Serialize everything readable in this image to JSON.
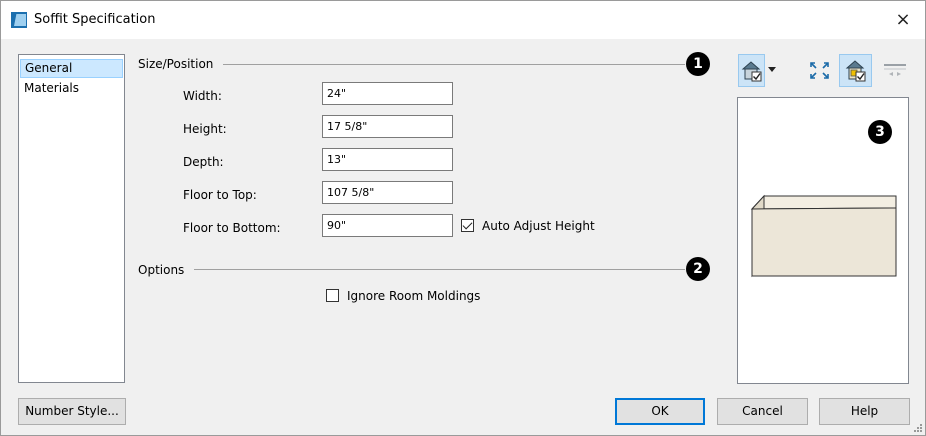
{
  "window": {
    "title": "Soffit Specification",
    "close_glyph": "×"
  },
  "sidebar": {
    "items": [
      {
        "label": "General",
        "selected": true
      },
      {
        "label": "Materials",
        "selected": false
      }
    ]
  },
  "size_position": {
    "title": "Size/Position",
    "callout": "1",
    "fields": {
      "width": {
        "label": "Width:",
        "value": "24\""
      },
      "height": {
        "label": "Height:",
        "value": "17 5/8\""
      },
      "depth": {
        "label": "Depth:",
        "value": "13\""
      },
      "floor_to_top": {
        "label": "Floor to Top:",
        "value": "107 5/8\""
      },
      "floor_to_bottom": {
        "label": "Floor to Bottom:",
        "value": "90\""
      }
    },
    "auto_adjust": {
      "label": "Auto Adjust Height",
      "checked": true
    }
  },
  "options": {
    "title": "Options",
    "callout": "2",
    "ignore_moldings": {
      "label": "Ignore Room Moldings",
      "checked": false
    }
  },
  "preview": {
    "callout": "3"
  },
  "toolbar": {
    "icons": [
      "view-render-icon",
      "dropdown-arrow-icon",
      "fill-window-icon",
      "show-selected-icon",
      "reference-plane-icon"
    ]
  },
  "buttons": {
    "number_style": "Number Style...",
    "ok": "OK",
    "cancel": "Cancel",
    "help": "Help"
  },
  "colors": {
    "selection": "#cce8ff",
    "soffit_face": "#ece6d8",
    "soffit_top": "#f3eee2",
    "soffit_side": "#e0d9c8",
    "accent": "#0078d7"
  }
}
